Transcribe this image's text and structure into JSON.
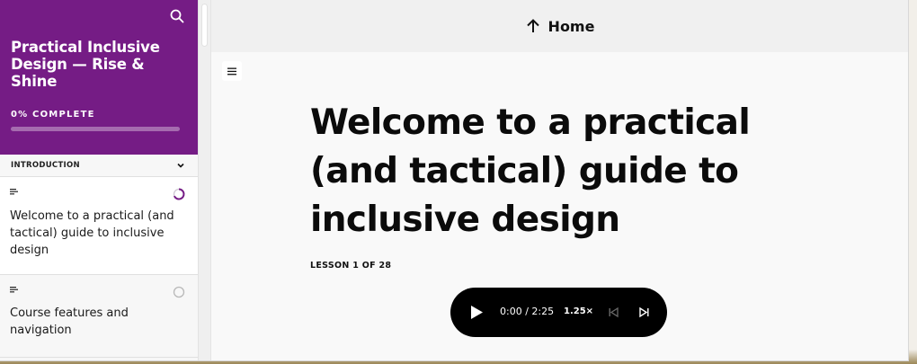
{
  "sidebar": {
    "course_title": "Practical Inclusive Design — Rise & Shine",
    "progress_label": "0% COMPLETE",
    "progress_fraction": 0,
    "section": {
      "label": "INTRODUCTION"
    },
    "lessons": [
      {
        "title": "Welcome to a practical (and tactical) guide to inclusive design",
        "status": "in-progress"
      },
      {
        "title": "Course features and navigation",
        "status": "not-started"
      }
    ]
  },
  "topbar": {
    "home_label": "Home"
  },
  "lesson": {
    "heading": "Welcome to a practical (and tactical) guide to inclusive design",
    "counter": "LESSON 1 OF 28"
  },
  "audio": {
    "time": "0:00 / 2:25",
    "speed": "1.25×"
  },
  "colors": {
    "brand": "#751c85",
    "player_bg": "#000000"
  },
  "icons": {
    "search": "search-icon",
    "chevron": "chevron-down-icon",
    "home": "arrow-up-icon",
    "menu": "hamburger-menu-icon",
    "play": "play-icon",
    "previous": "skip-back-icon",
    "next": "skip-forward-icon"
  }
}
